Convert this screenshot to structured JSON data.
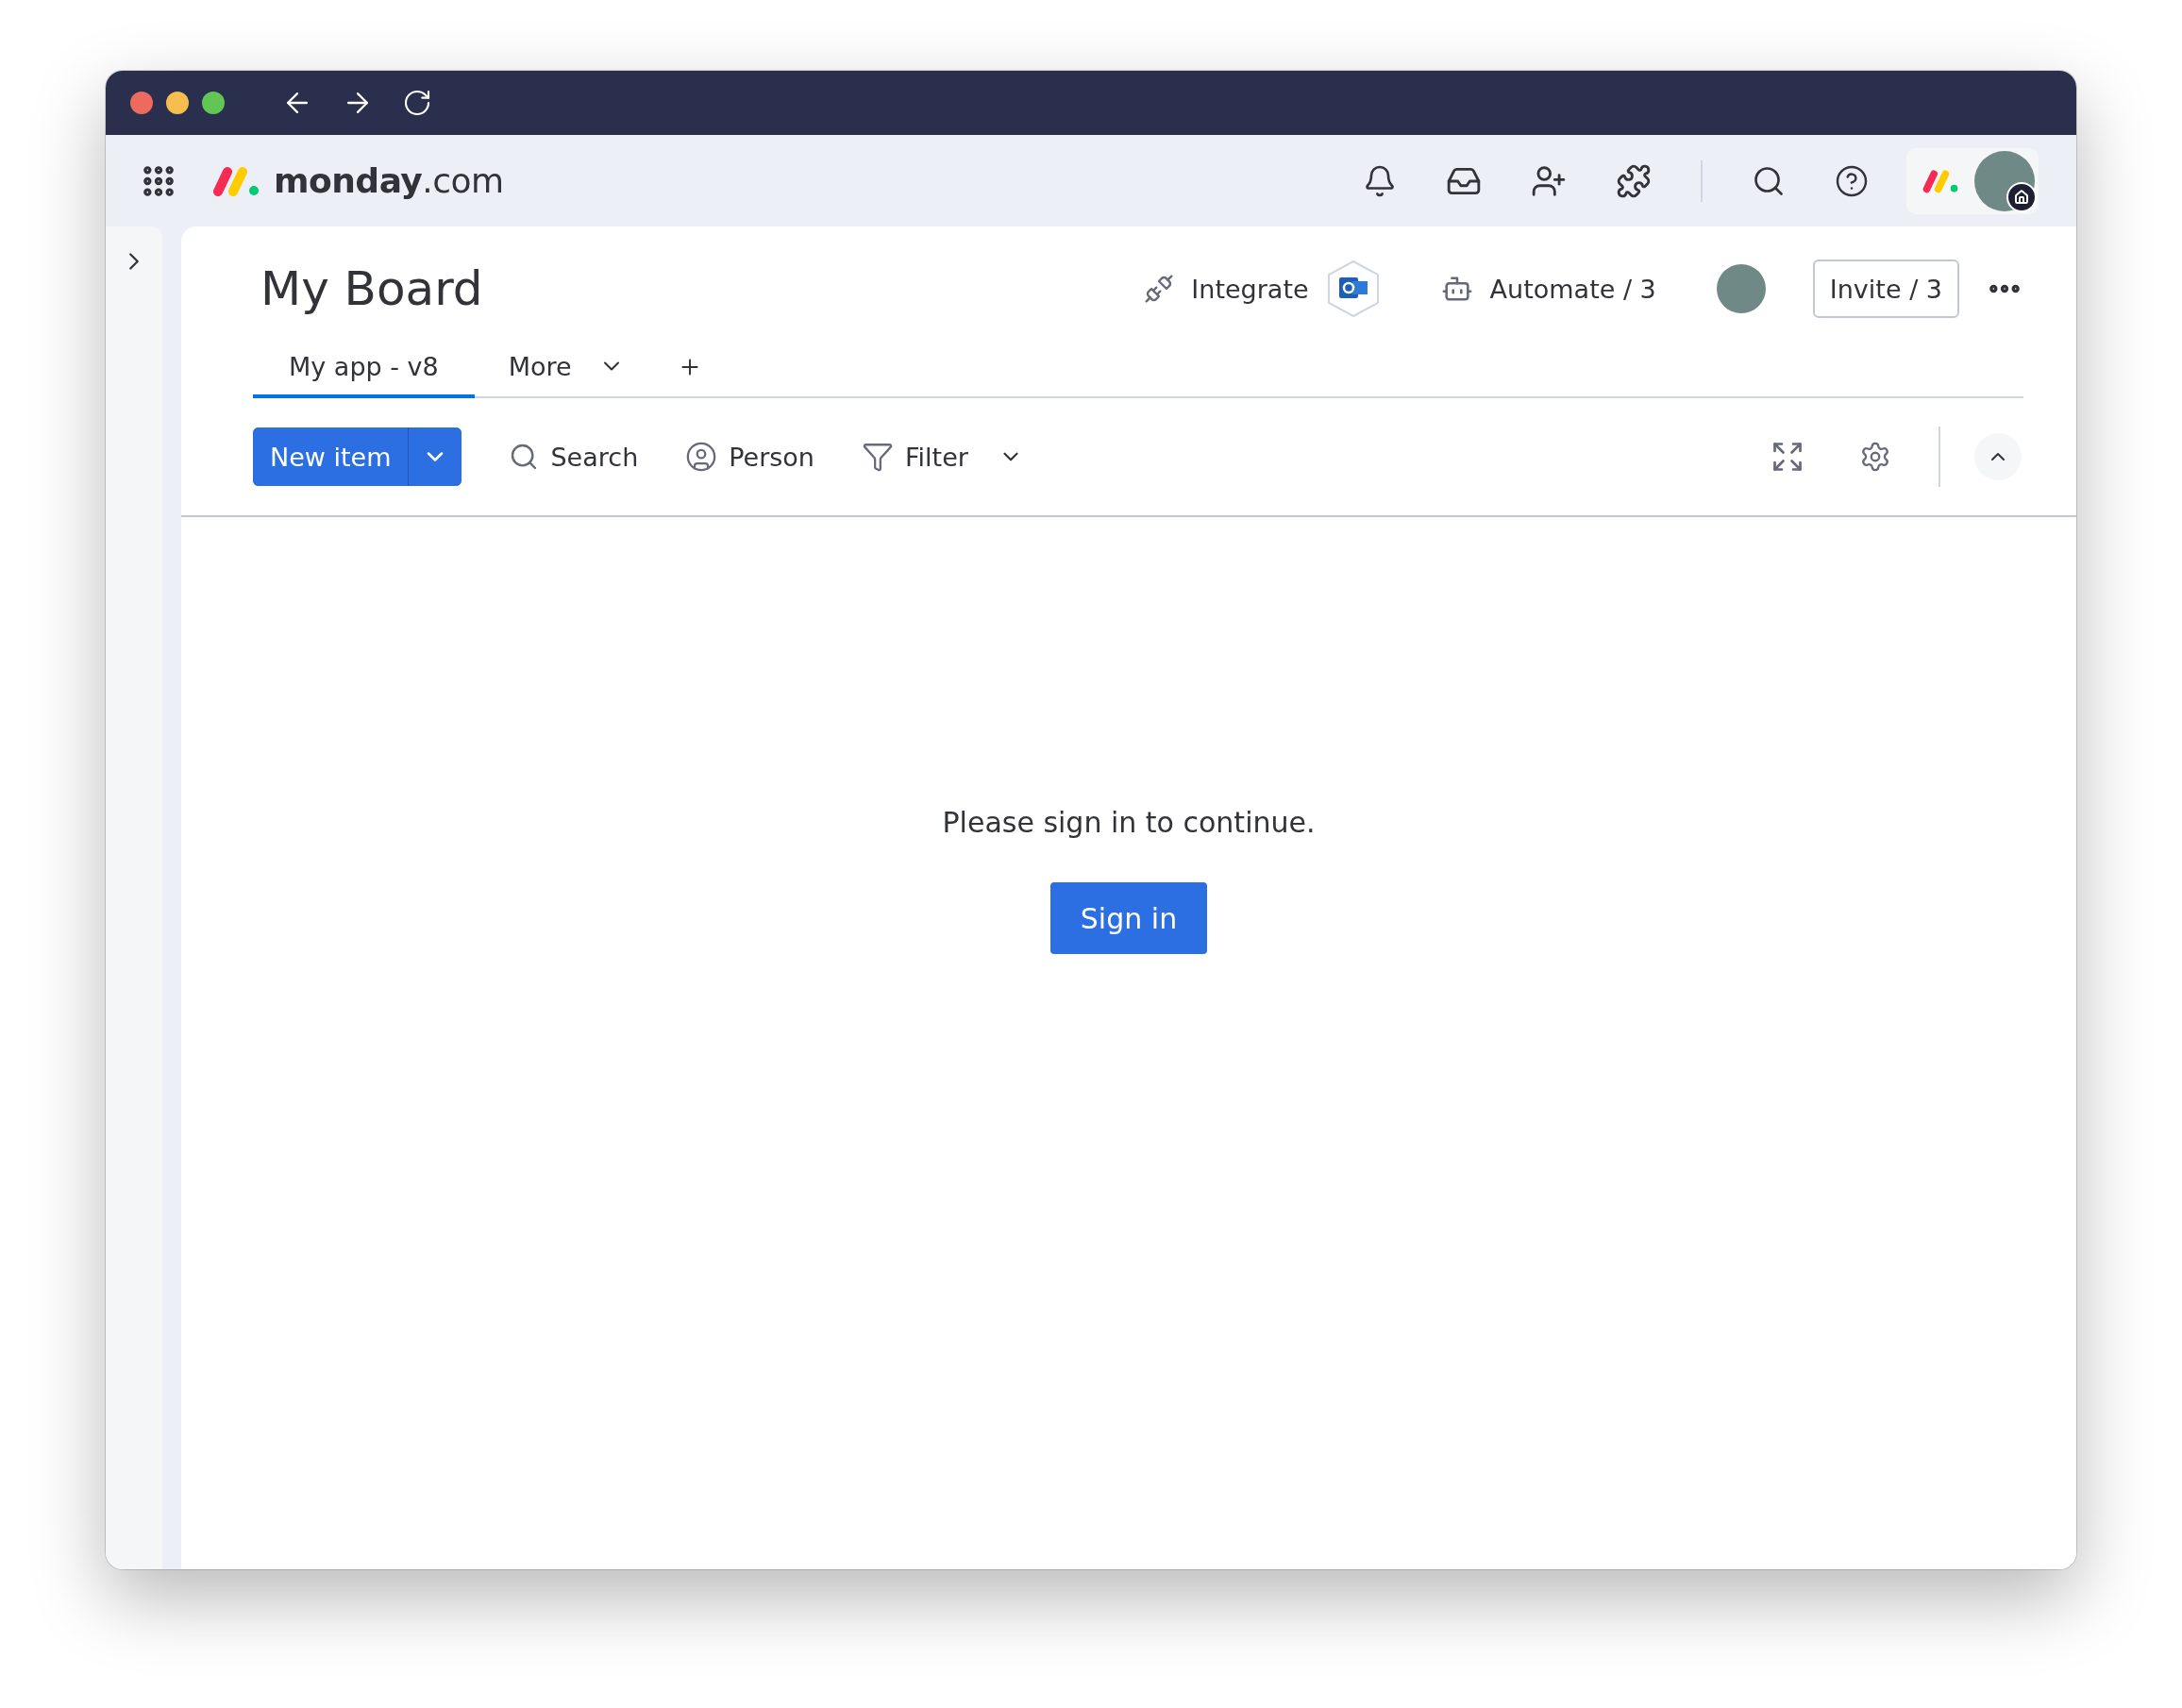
{
  "brand": {
    "logo_text": "**monday**.com"
  },
  "board": {
    "title": "My Board",
    "integrate": "Integrate",
    "automate": "Automate / 3",
    "invite": "Invite / 3"
  },
  "tabs": [
    {
      "label": "My app - v8",
      "selected": true,
      "kind": "view"
    },
    {
      "label": "More",
      "selected": false,
      "kind": "dropdown"
    }
  ],
  "toolbar": {
    "new_item": "New item",
    "search": "Search",
    "person": "Person",
    "filter": "Filter"
  },
  "message": "Please sign in to continue.",
  "sign_in": "Sign in"
}
